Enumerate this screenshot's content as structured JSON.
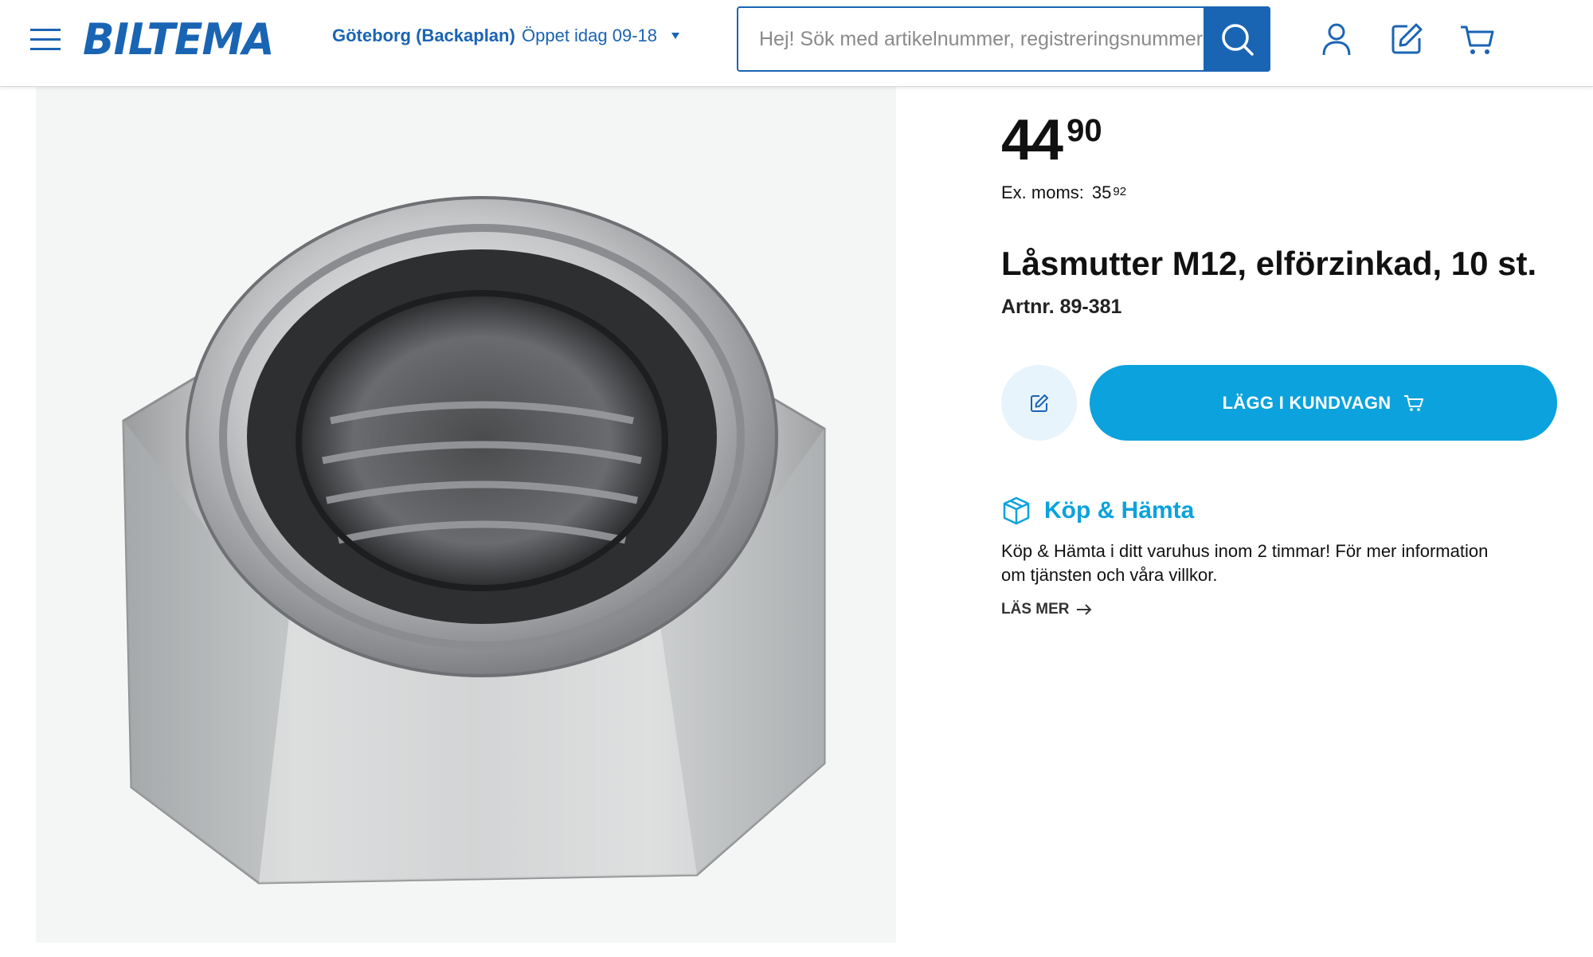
{
  "header": {
    "logo_text": "BILTEMA",
    "store_name": "Göteborg (Backaplan)",
    "store_hours": "Öppet idag 09-18",
    "search_placeholder": "Hej! Sök med artikelnummer, registreringsnummer",
    "icons": [
      "menu-icon",
      "search-icon",
      "user-icon",
      "edit-note-icon",
      "cart-icon"
    ]
  },
  "product": {
    "price_main": "44",
    "price_decimals": "90",
    "ex_moms_label": "Ex. moms:",
    "ex_moms_main": "35",
    "ex_moms_decimals": "92",
    "title": "Låsmutter M12, elförzinkad, 10 st.",
    "article_number": "Artnr. 89-381",
    "add_to_cart_label": "LÄGG I KUNDVAGN",
    "image_icon": "lock-nut-photo"
  },
  "click_collect": {
    "title": "Köp & Hämta",
    "text": "Köp & Hämta i ditt varuhus inom 2 timmar! För mer information om tjänsten och våra villkor.",
    "read_more_label": "LÄS MER"
  },
  "colors": {
    "brand_blue": "#1a64b4",
    "accent_blue": "#0ba2dd",
    "light_blue": "#e7f4fb"
  }
}
